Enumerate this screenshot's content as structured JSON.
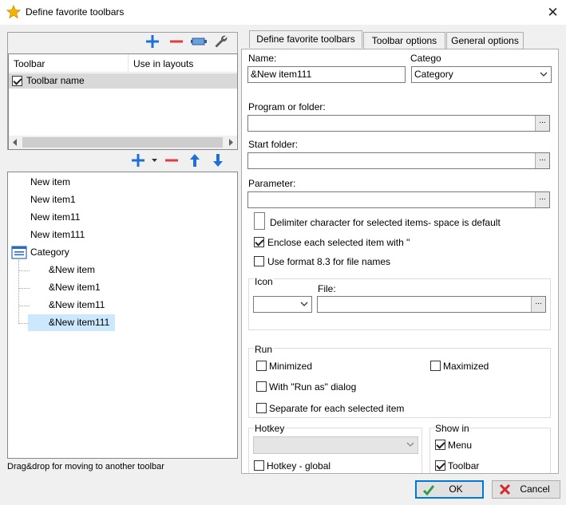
{
  "window": {
    "title": "Define favorite toolbars",
    "close_glyph": "✕",
    "icon": "star-icon"
  },
  "toolbars_panel": {
    "columns": [
      "Toolbar",
      "Use in layouts"
    ],
    "rows": [
      {
        "name": "Toolbar name",
        "checked": true
      }
    ],
    "icons": [
      "plus-icon",
      "minus-icon",
      "battery-icon",
      "wrench-icon"
    ]
  },
  "items_panel": {
    "icons": [
      "plus-icon",
      "dropdown-arrow-icon",
      "minus-icon",
      "arrow-up-icon",
      "arrow-down-icon"
    ],
    "tree": [
      {
        "label": "New item",
        "level": 0
      },
      {
        "label": "New item1",
        "level": 0
      },
      {
        "label": "New item11",
        "level": 0
      },
      {
        "label": "New item111",
        "level": 0
      },
      {
        "label": "Category",
        "level": 0,
        "icon": "category-icon"
      },
      {
        "label": "&New item",
        "level": 1
      },
      {
        "label": "&New item1",
        "level": 1
      },
      {
        "label": "&New item11",
        "level": 1
      },
      {
        "label": "&New item111",
        "level": 1,
        "selected": true
      }
    ],
    "hint": "Drag&drop for moving to another toolbar"
  },
  "tabs": [
    {
      "label": "Define favorite toolbars",
      "active": true
    },
    {
      "label": "Toolbar options",
      "active": false
    },
    {
      "label": "General options",
      "active": false
    }
  ],
  "form": {
    "name_label": "Name:",
    "name_value": "&New item111",
    "category_label": "Catego",
    "category_value": "Category",
    "program_label": "Program or folder:",
    "program_value": "",
    "start_folder_label": "Start folder:",
    "start_folder_value": "",
    "parameter_label": "Parameter:",
    "parameter_value": "",
    "browse_glyph": "...",
    "delimiter_label": "Delimiter character for selected items- space is default",
    "enclose_label": "Enclose each selected item with \"",
    "enclose_checked": true,
    "format83_label": "Use format 8.3 for file names",
    "format83_checked": false,
    "icon_group_label": "Icon",
    "file_label": "File:",
    "run_group_label": "Run",
    "minimized_label": "Minimized",
    "maximized_label": "Maximized",
    "run_as_label": "With \"Run as\" dialog",
    "separate_label": "Separate for each selected item",
    "hotkey_group_label": "Hotkey",
    "hotkey_global_label": "Hotkey - global",
    "show_in_group_label": "Show in",
    "show_menu_label": "Menu",
    "show_menu_checked": true,
    "show_toolbar_label": "Toolbar",
    "show_toolbar_checked": true
  },
  "buttons": {
    "ok_label": "OK",
    "cancel_label": "Cancel"
  },
  "colors": {
    "accent_blue": "#1e6fd6",
    "minus_red": "#e03c3c",
    "selection": "#cce8ff",
    "ok_green": "#2e9e48",
    "cancel_red": "#d22b2b"
  }
}
